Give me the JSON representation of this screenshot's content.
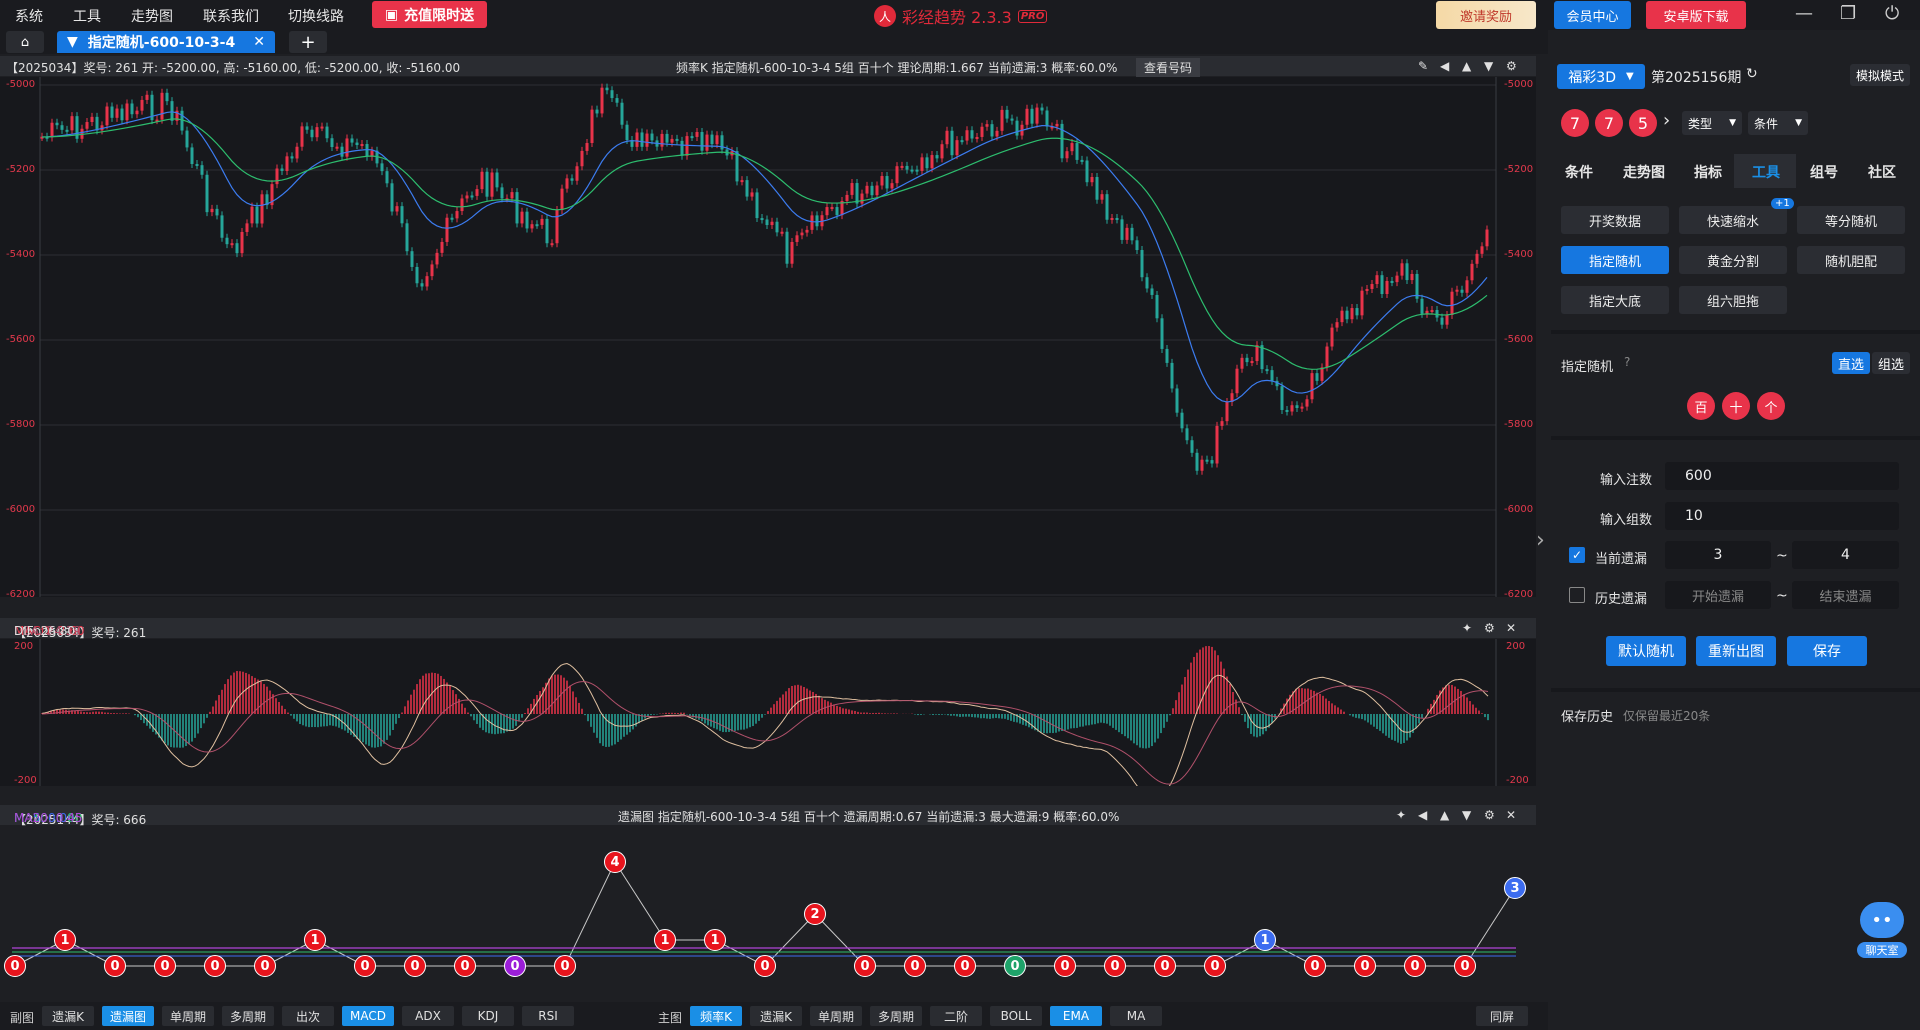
{
  "menu": [
    "系统",
    "工具",
    "走势图",
    "联系我们",
    "切换线路"
  ],
  "promo_label": "充值限时送",
  "app_title": "彩经趋势 2.3.3",
  "app_badge": "PRO",
  "top_buttons": {
    "invite": "邀请奖励",
    "member": "会员中心",
    "android": "安卓版下载"
  },
  "tab": {
    "title": "指定随机-600-10-3-4",
    "add": "+"
  },
  "main_chart": {
    "header_left": "【2025034】奖号: 261  开: -5200.00, 高: -5160.00, 低: -5200.00, 收: -5160.00",
    "header_mid": "频率K  指定随机-600-10-3-4  5组  百十个  理论周期:1.667  当前遗漏:3  概率:60.0%",
    "check_btn": "查看号码",
    "y_ticks": [
      "-5000",
      "-5200",
      "-5400",
      "-5600",
      "-5800",
      "-6000",
      "-6200"
    ]
  },
  "macd_panel": {
    "header_prefix": "【2025034】奖号: 261",
    "macd": "MACD: 2.60",
    "dea": "DEA: 24.19",
    "dif": "DIF: 26.80",
    "y_top": "200",
    "y_bottom": "-200"
  },
  "miss_panel": {
    "header_prefix": "【2025144】奖号: 666",
    "ma5": "MA5: 0.00",
    "ma10": "MA10: 0.80",
    "ma20": "MA20: 0.45",
    "header_mid": "遗漏图  指定随机-600-10-3-4  5组  百十个  遗漏周期:0.67  当前遗漏:3  最大遗漏:9  概率:60.0%",
    "values": [
      0,
      1,
      0,
      0,
      0,
      0,
      1,
      0,
      0,
      0,
      0,
      0,
      4,
      1,
      1,
      0,
      2,
      0,
      0,
      0,
      0,
      0,
      0,
      0,
      0,
      1,
      0,
      0,
      0,
      0,
      3
    ]
  },
  "bottom_bar": {
    "sub_label": "副图",
    "sub": [
      "遗漏K",
      "遗漏图",
      "单周期",
      "多周期",
      "出次",
      "MACD",
      "ADX",
      "KDJ",
      "RSI"
    ],
    "main_label": "主图",
    "main": [
      "频率K",
      "遗漏K",
      "单周期",
      "多周期",
      "二阶",
      "BOLL",
      "EMA",
      "MA"
    ],
    "same_screen": "同屏"
  },
  "side": {
    "lottery": "福彩3D",
    "period": "第2025156期",
    "mode": "模拟模式",
    "balls": [
      "7",
      "7",
      "5"
    ],
    "type_label": "类型",
    "cond_label": "条件",
    "tabs": [
      "条件",
      "走势图",
      "指标",
      "工具",
      "组号",
      "社区"
    ],
    "tools": [
      "开奖数据",
      "快速缩水",
      "等分随机",
      "指定随机",
      "黄金分割",
      "随机胆配",
      "指定大底",
      "组六胆拖"
    ],
    "badge": "+1",
    "section_title": "指定随机",
    "direct": "直选",
    "group": "组选",
    "pos": [
      "百",
      "十",
      "个"
    ],
    "bet_label": "输入注数",
    "bet_value": "600",
    "group_label": "输入组数",
    "group_value": "10",
    "cur_miss_label": "当前遗漏",
    "cur_from": "3",
    "cur_to": "4",
    "tilde": "~",
    "hist_miss_label": "历史遗漏",
    "hist_from": "开始遗漏",
    "hist_to": "结束遗漏",
    "btn_default": "默认随机",
    "btn_redraw": "重新出图",
    "btn_save": "保存",
    "history_title": "保存历史",
    "history_note": "仅保留最近20条",
    "chat": "聊天室"
  },
  "colors": {
    "accent": "#1677e0",
    "red": "#e8334a",
    "up": "#e8334a",
    "down": "#26a69a"
  }
}
